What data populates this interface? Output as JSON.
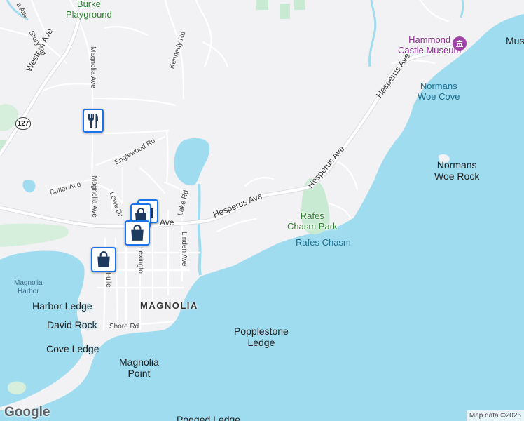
{
  "map": {
    "places": {
      "burke_playground": "Burke\nPlayground",
      "magnolia": "MAGNOLIA",
      "magnolia_harbor": "Magnolia\nHarbor"
    },
    "pois": {
      "hammond_castle": "Hammond\nCastle Museum",
      "rafes_chasm_park": "Rafes\nChasm Park",
      "rafes_chasm": "Rafes Chasm"
    },
    "coast": {
      "normans_woe_cove": "Normans\nWoe Cove"
    },
    "water": {
      "normans_woe_rock": "Normans\nWoe Rock",
      "harbor_ledge": "Harbor Ledge",
      "david_rock": "David Rock",
      "cove_ledge": "Cove Ledge",
      "magnolia_point": "Magnolia\nPoint",
      "popplestone_ledge": "Popplestone\nLedge",
      "pogged_ledge": "Pogged Ledge",
      "mus": "Mus"
    },
    "roads": {
      "western_ave": "Western Ave",
      "hesperus_ave_1": "Hesperus Ave",
      "hesperus_ave_2": "Hesperus Ave",
      "hesperus_ave_3": "Hesperus Ave",
      "story_rd": "Story Rd",
      "magnolia_ave_north": "Magnolia Ave",
      "magnolia_ave_south": "Magnolia Ave",
      "kennedy_rd": "Kennedy Rd",
      "englewood_rd": "Englewood Rd",
      "butler_ave": "Butler Ave",
      "lowe_dr": "Lowe Dr",
      "lake_rd": "Lake Rd",
      "linden_ave": "Linden Ave",
      "lexington": "Lexingto",
      "fuller": "Fulle",
      "shore_rd": "Shore Rd",
      "ave_fragment": "Ave",
      "top_left_fragment": "a Ave"
    },
    "route_shield": "127",
    "markers": [
      {
        "name": "restaurant-marker",
        "icon": "fork-knife-icon"
      },
      {
        "name": "shopping-marker-1",
        "icon": "shopping-bag-icon"
      },
      {
        "name": "shopping-marker-2",
        "icon": "shopping-bag-icon"
      },
      {
        "name": "shopping-marker-3",
        "icon": "shopping-bag-icon"
      },
      {
        "name": "shopping-marker-4",
        "icon": "shopping-bag-icon"
      }
    ],
    "logo": "Google",
    "attribution": "Map data ©2026"
  },
  "colors": {
    "water": "#9fdcf0",
    "land": "#f2f2f4",
    "park": "#c8ead2",
    "road": "#ffffff",
    "marker_border": "#1a73e8",
    "marker_icon": "#1e3a5f",
    "poi": "#a142a8"
  }
}
